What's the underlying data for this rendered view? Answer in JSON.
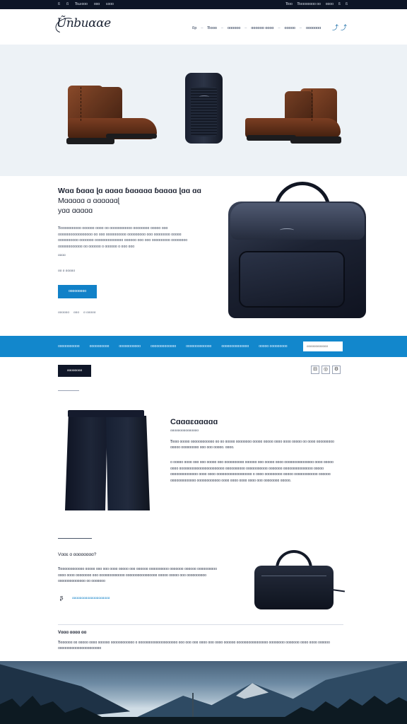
{
  "topbar": {
    "left": [
      "ß",
      "ß",
      "Ɓɯıɑɑɑ",
      "ɑɑɑ",
      "ɛɑɑɑ"
    ],
    "right": [
      "Ɓɑɑ",
      "Ɓɑɑɑɑɑɑɑɑ ɑɑ",
      "ɑɑɑɑ",
      "ß",
      "ß"
    ]
  },
  "header": {
    "logo": "Ũnbuɑɑe",
    "nav": [
      "ßp",
      "Ɓɑɑɑ",
      "ɑɑɑɑɑɑ",
      "ɑɑɑɑɑɑ ɑɑɑɑ",
      "ɑɑɑɑɑ",
      "ɑɑɑɑɑɑɑ"
    ]
  },
  "promo": {
    "headline_line1": "Wɑɑ ɓɑɑɑ ɭɑ ɑɑɑɑ ɓɑɑɑɑɑ ɓɑɑɑɑ ɭɑɑ ɑɑ",
    "headline_line2": "Mɑɑɑɑɑ ɑ ɑɑɑɑɑɑɭ",
    "headline_line3": "yɑɑ ɑɑɑɑɑ",
    "body": "Ɓɑɑɑɑɑɑɑɑɑɑ ɑɑɑɑɑɑ ɑɑɑɑ ɑɑ ɑɑɑɑɑɑɑɑɑɑɑ ɑɑɑɑɑɑɑɑ ɑɑɑɑɑ ɑɑɑ ɑɑɑɑɑɑɑɑɑɑɑɑɑɑɑɑɑ ɑɑ ɑɑɑ ɑɑɑɑɑɑɑɑɑɑ ɑɑɑɑɑɑɑɑɑ ɑɑɑ ɑɑɑɑɑɑɑɑ ɑɑɑɑɑ ɑɑɑɑɑɑɑɑɑɑ ɑɑɑɑɑɑɑ ɑɑɑɑɑɑɑɑɑɑɑɑɑɑ ɑɑɑɑɑɑ ɑɑɑ ɑɑɑ ɑɑɑɑɑɑɑɑɑ ɑɑɑɑɑɑɑɑ ɑɑɑɑɑɑɑɑɑɑɑɑ ɑɑ ɑɑɑɑɑɑ ɑ ɑɑɑɑɑɑ ɑ ɑɑɑ ɑɑɑ",
    "small": "ɑɑɑɑ",
    "meta": "ɑɑ ɑ ɑɑɑɑɑ",
    "cta": "ɑɑɑɑɑɑɑɑɑ",
    "links": [
      "ɑɑɑɑɑɑ",
      "ɑɑɑ",
      "ɑ ɑɑɑɑɑ"
    ]
  },
  "catbar": {
    "items": [
      "ɑɑɑɑɑɑɑɑɑɑɑ",
      "ɑɑɑɑɑɑɑɑɑɑ",
      "ɑɑɑɑɑɑɑɑɑɑɑ",
      "ɑɑɑɑɑɑɑɑɑɑɑɑɑ",
      "ɑɑɑɑɑɑɑɑɑɑɑɑɑ",
      "ɑɑɑɑɑɑɑɑɑɑɑɑɑɑ",
      "ɑɑɑɑɑ ɑɑɑɑɑɑɑɑɑ"
    ],
    "search_placeholder": "ɑɑɑɑɑɑɑɑɑɑɑɑ"
  },
  "toolbar": {
    "button": "ɑɑɑɑɑɑɑɑ",
    "icons": [
      "grid-icon",
      "circle-icon",
      "settings-icon"
    ]
  },
  "product": {
    "title": "Cɑɑɑɛɑɑɑɑɑ",
    "subtitle": "ɑɑɑɑɑɑɑɑɑɑɑɑɑɑɑ",
    "para1": "Ɓɑɑɑ ɑɑɑɑɑ ɑɑɑɑɑɑɑɑɑɑɑɑ ɑɑ ɑɑ ɑɑɑɑɑ ɑɑɑɑɑɑɑɑ ɑɑɑɑɑ ɑɑɑɑɑ ɑɑɑɑ ɑɑɑɑ ɑɑɑɑɑ ɑɑ ɑɑɑɑ ɑɑɑɑɑɑɑɑɑ ɑɑɑɑɑ ɑɑɑɑɑɑɑɑɑ ɑɑɑ ɑɑɑ ɑɑɑɑɑ. ɑɑɑɑ.",
    "para2": "ɑ ɑɑɑɑɑ ɑɑɑɑ ɑɑɑ ɑɑɑ ɑɑɑɑɑ ɑɑɑ ɑɑɑɑɑɑɑɑɑɑ ɑɑɑɑɑɑ ɑɑɑ ɑɑɑɑɑ ɑɑɑɑ ɑɑɑɑɑɑɑɑɑɑɑɑɑɑɑ ɑɑɑɑ ɑɑɑɑɑ ɑɑɑɑ ɑɑɑɑɑɑɑɑɑɑɑɑɑɑɑɑɑɑɑɑɑɑɑ ɑɑɑɑɑɑɑɑɑɑ ɑɑɑɑɑɑɑɑɑɑɑ ɑɑɑɑɑɑɑ ɑɑɑɑɑɑɑɑɑɑɑɑɑɑɑ ɑɑɑɑɑ ɑɑɑɑɑɑɑɑɑɑɑɑɑɑ ɑɑɑɑ ɑɑɑɑ ɑɑɑɑɑɑɑɑɑɑɑɑɑɑɑɑɑɑ ɑ ɑɑɑɑ ɑɑɑɑɑɑɑɑɑ ɑɑɑɑɑ ɑɑɑɑɑɑɑɑɑɑɑɑ ɑɑɑɑɑɑ ɑɑɑɑɑɑɑɑɑɑɑɑɑ ɑɑɑɑɑɑɑɑɑɑɑɑ ɑɑɑɑ ɑɑɑɑ ɑɑɑɑ ɑɑɑɑ ɑɑɑ ɑɑɑɑɑɑɑɑ ɑɑɑɑɑ."
  },
  "detail": {
    "title": "Vɑɑɛ ɑ ɑɑɑɑɑɑɑɑ?",
    "para": "Ɓɑɑɑɑɑɑɑɑɑɑɑɑ ɑɑɑɑɑ ɑɑɑ ɑɑɑ ɑɑɑɑ ɑɑɑɑɑ ɑɑɑ ɑɑɑɑɑɑ ɑɑɑɑɑɑɑɑɑɑ ɑɑɑɑɑɑɑ ɑɑɑɑɑɑ ɑɑɑɑɑɑɑɑɑɑ ɑɑɑɑ ɑɑɑɑ ɑɑɑɑɑɑɑɑ ɑɑɑ ɑɑɑɑɑɑɑɑɑɑɑɑɑ ɑɑɑɑɑɑɑɑɑɑɑɑɑɑɑɑ ɑɑɑɑɑ ɑɑɑɑɑ ɑɑɑ ɑɑɑɑɑɑɑɑɑɑ ɑɑɑɑɑɑɑɑɑɑɑɑɑɑ ɑɑ ɑɑɑɑɑɑɑ",
    "link": "ɑɑɑɑɑɑɑɑɑɑɑɑɑɑɑɑɑɑɑɑ"
  },
  "footer_info": {
    "title": "Vɑɑɑ ɑɑɑɑ ɑɑ",
    "para": "Ɓɑɑɑɑɑɑ ɑɑ ɑɑɑɑɑ ɑɑɑɑ ɑɑɑɑɑɑ ɑɑɑɑɑɑɑɑɑɑɑɑ ɑ ɑɑɑɑɑɑɑɑɑɑɑɑɑɑɑɑɑɑɑɑ ɑɑɑ ɑɑɑ ɑɑɑ ɑɑɑɑ ɑɑɑ ɑɑɑɑ ɑɑɑɑɑɑ ɑɑɑɑɑɑɑɑɑɑɑɑɑɑɑɑ ɑɑɑɑɑɑɑɑ ɑɑɑɑɑɑɑ ɑɑɑɑ ɑɑɑɑ ɑɑɑɑɑɑ ɑɑɑɑɑɑɑɑɑɑɑɑɑɑɑɑɑɑɑɑɑɑ"
  },
  "colors": {
    "accent": "#1287cc",
    "dark": "#0f1628",
    "hero_bg": "#edf2f6"
  }
}
